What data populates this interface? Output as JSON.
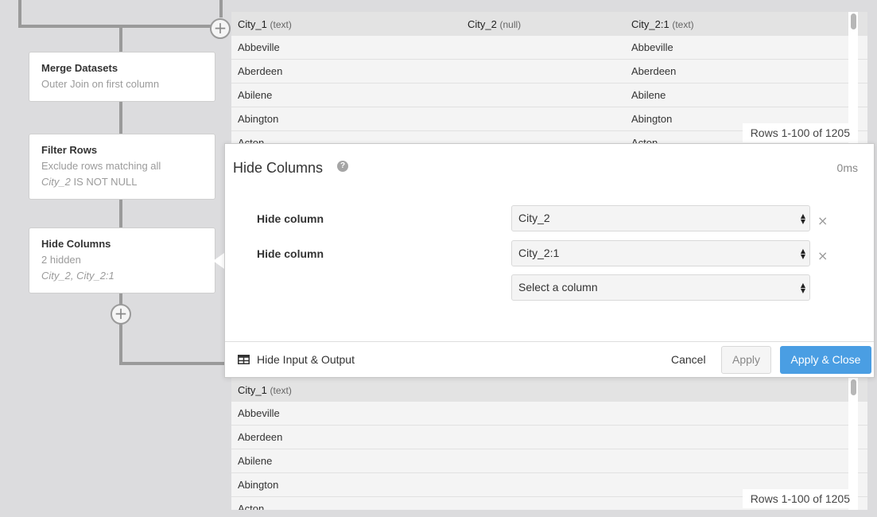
{
  "steps": [
    {
      "title": "Merge Datasets",
      "line1": "Outer Join on first column"
    },
    {
      "title": "Filter Rows",
      "line1": "Exclude rows matching all",
      "line2_em": "City_2",
      "line2_rest": " IS NOT NULL"
    },
    {
      "title": "Hide Columns",
      "line1": "2 hidden",
      "line2_em": "City_2, City_2:1"
    }
  ],
  "input_table": {
    "columns": [
      {
        "name": "City_1",
        "type": "(text)"
      },
      {
        "name": "City_2",
        "type": "(null)"
      },
      {
        "name": "City_2:1",
        "type": "(text)"
      }
    ],
    "rows": [
      [
        "Abbeville",
        "",
        "Abbeville"
      ],
      [
        "Aberdeen",
        "",
        "Aberdeen"
      ],
      [
        "Abilene",
        "",
        "Abilene"
      ],
      [
        "Abington",
        "",
        "Abington"
      ],
      [
        "Acton",
        "",
        "Acton"
      ]
    ],
    "rows_count": "Rows 1-100 of 1205"
  },
  "output_table": {
    "columns": [
      {
        "name": "City_1",
        "type": "(text)"
      }
    ],
    "rows": [
      [
        "Abbeville"
      ],
      [
        "Aberdeen"
      ],
      [
        "Abilene"
      ],
      [
        "Abington"
      ],
      [
        "Acton"
      ]
    ],
    "rows_count": "Rows 1-100 of 1205"
  },
  "modal": {
    "title": "Hide Columns",
    "help_icon": "?",
    "timing": "0ms",
    "params": [
      {
        "label": "Hide column",
        "value": "City_2"
      },
      {
        "label": "Hide column",
        "value": "City_2:1"
      },
      {
        "label": "",
        "value": "Select a column"
      }
    ],
    "remove_icon": "×",
    "footer": {
      "toggle_label": "Hide Input & Output",
      "cancel_label": "Cancel",
      "apply_label": "Apply",
      "apply_close_label": "Apply & Close"
    }
  },
  "plus_icon": "+",
  "colors": {
    "accent": "#4a9ee3",
    "canvas": "#dcdcde",
    "flow_line": "#9a9a9a"
  },
  "icons": {
    "add_step": "plus-icon",
    "remove": "close-icon",
    "toggle": "table-icon",
    "help": "help-icon",
    "select": "select-arrows-icon"
  }
}
